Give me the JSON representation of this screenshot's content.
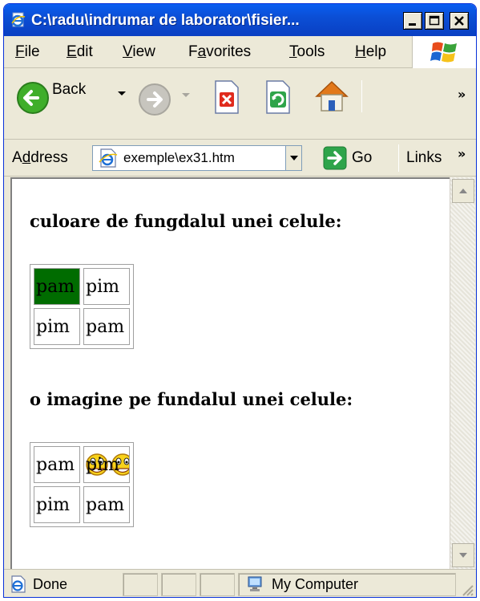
{
  "window": {
    "title": "C:\\radu\\indrumar de laborator\\fisier..."
  },
  "menu": {
    "items": [
      {
        "pre": "",
        "u": "F",
        "post": "ile"
      },
      {
        "pre": "",
        "u": "E",
        "post": "dit"
      },
      {
        "pre": "",
        "u": "V",
        "post": "iew"
      },
      {
        "pre": "F",
        "u": "a",
        "post": "vorites"
      },
      {
        "pre": "",
        "u": "T",
        "post": "ools"
      },
      {
        "pre": "",
        "u": "H",
        "post": "elp"
      }
    ]
  },
  "toolbar": {
    "back_label": "Back",
    "chevron": "»"
  },
  "address": {
    "label_pre": "A",
    "label_u": "d",
    "label_post": "dress",
    "value": "exemple\\ex31.htm",
    "go_label": "Go",
    "links_label": "Links",
    "chevron": "»"
  },
  "page": {
    "heading1": "culoare de fungdalul unei celule:",
    "table1": [
      [
        "pam",
        "pim"
      ],
      [
        "pim",
        "pam"
      ]
    ],
    "heading2": "o imagine pe fundalul unei celule:",
    "table2": [
      [
        "pam",
        "pim"
      ],
      [
        "pim",
        "pam"
      ]
    ]
  },
  "status": {
    "left": "Done",
    "zone": "My Computer"
  },
  "colors": {
    "cell_green": "#006c00",
    "title_blue": "#0b4fd6"
  }
}
